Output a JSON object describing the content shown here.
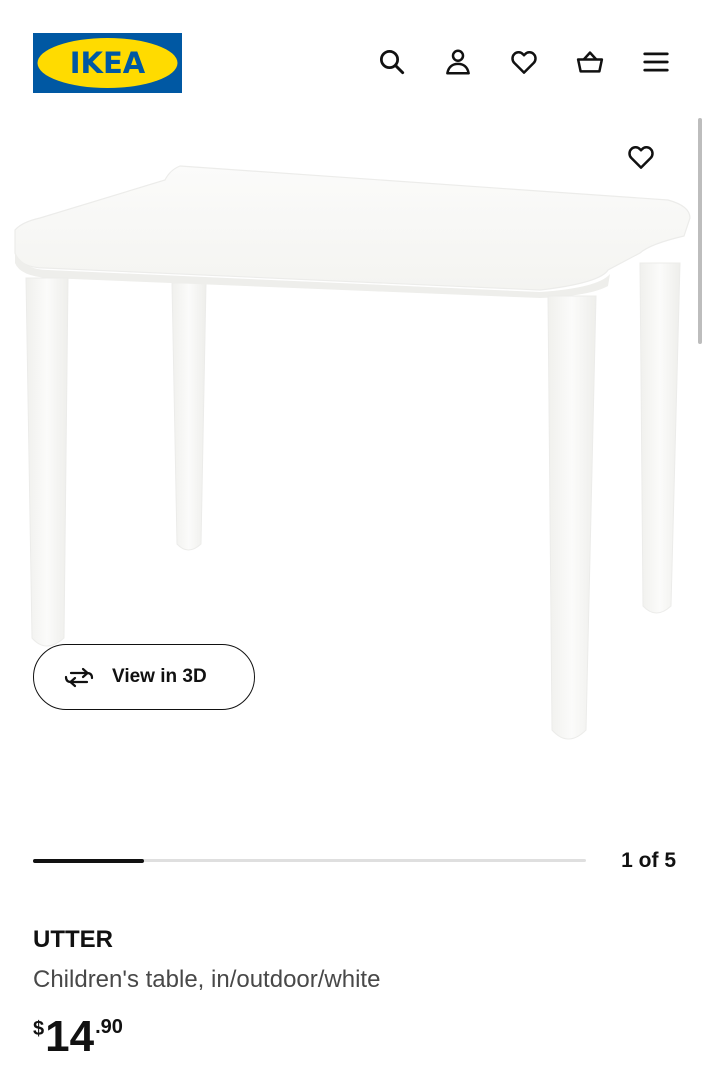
{
  "header": {
    "logo_text": "IKEA",
    "brand_colors": {
      "blue": "#0058a3",
      "yellow": "#ffdb00"
    },
    "icons": [
      "search-icon",
      "account-icon",
      "heart-icon",
      "basket-icon",
      "menu-icon"
    ]
  },
  "gallery": {
    "image": "children's table, white",
    "view_3d_label": "View in 3D",
    "current": "1",
    "of_word": "of",
    "total": "5",
    "progress_fraction": 0.2
  },
  "product": {
    "name": "UTTER",
    "description": "Children's table, in/outdoor/white",
    "price_currency": "$",
    "price_integer": "14",
    "price_decimal": ".90"
  }
}
